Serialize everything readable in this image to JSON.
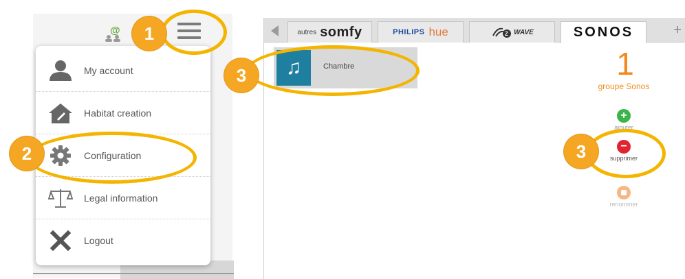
{
  "menu": {
    "items": [
      {
        "label": "My account",
        "icon": "user-icon"
      },
      {
        "label": "Habitat creation",
        "icon": "house-icon"
      },
      {
        "label": "Configuration",
        "icon": "gear-icon"
      },
      {
        "label": "Legal information",
        "icon": "scales-icon"
      },
      {
        "label": "Logout",
        "icon": "close-icon"
      }
    ]
  },
  "header": {
    "at_symbol": "@",
    "hamburger_icon": "hamburger-menu-icon"
  },
  "tabs": {
    "somfy_prefix": "autres",
    "somfy_brand": "somfy",
    "philips": "PHILIPS",
    "hue": "hue",
    "zwave": "WAVE",
    "sonos": "SONOS",
    "plus": "+"
  },
  "rooms": [
    {
      "label": "Chambre",
      "icon": "music-note-icon"
    }
  ],
  "summary": {
    "count": "1",
    "label": "groupe Sonos"
  },
  "actions": {
    "add": "ajouter",
    "delete": "supprimer",
    "rename": "renommer"
  },
  "annotations": {
    "badge_1": "1",
    "badge_2": "2",
    "badge_3a": "3",
    "badge_3b": "3"
  },
  "colors": {
    "annotation": "#f5a623",
    "sonos_orange": "#f08a1c",
    "add_green": "#3bb54a",
    "delete_red": "#e02431",
    "room_tile": "#1f7fa0"
  }
}
